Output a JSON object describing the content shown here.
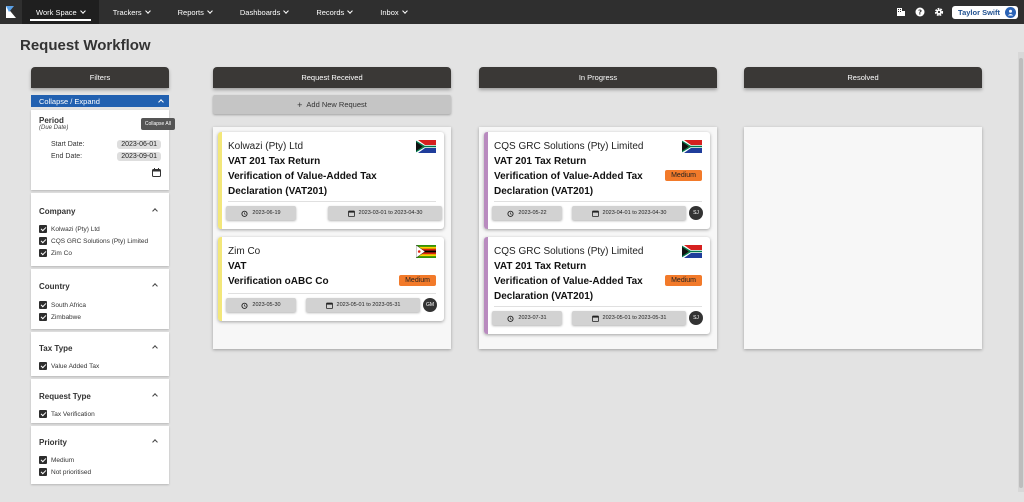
{
  "nav": {
    "items": [
      {
        "label": "Work Space",
        "active": true
      },
      {
        "label": "Trackers"
      },
      {
        "label": "Reports"
      },
      {
        "label": "Dashboards"
      },
      {
        "label": "Records"
      },
      {
        "label": "Inbox"
      }
    ],
    "user_name": "Taylor Swift"
  },
  "page": {
    "title": "Request Workflow"
  },
  "filters": {
    "header": "Filters",
    "collapse_label": "Collapse / Expand",
    "tooltip": "Collapse All",
    "period": {
      "title": "Period",
      "subtitle": "(Due Date)",
      "start_label": "Start Date:",
      "start_value": "2023-06-01",
      "end_label": "End Date:",
      "end_value": "2023-09-01"
    },
    "company": {
      "title": "Company",
      "options": [
        "Kolwazi (Pty) Ltd",
        "CQS GRC Solutions (Pty) Limited",
        "Zim Co"
      ]
    },
    "country": {
      "title": "Country",
      "options": [
        "South Africa",
        "Zimbabwe"
      ]
    },
    "tax_type": {
      "title": "Tax Type",
      "options": [
        "Value Added Tax"
      ]
    },
    "request_type": {
      "title": "Request Type",
      "options": [
        "Tax Verification"
      ]
    },
    "priority": {
      "title": "Priority",
      "options": [
        "Medium",
        "Not prioritised"
      ]
    }
  },
  "columns": {
    "received": {
      "title": "Request Received",
      "add_label": "Add New Request",
      "cards": [
        {
          "company": "Kolwazi (Pty) Ltd",
          "tax": "VAT 201 Tax Return",
          "desc1": "Verification of Value-Added Tax",
          "desc2": "Declaration (VAT201)",
          "due": "2023-06-19",
          "range": "2023-03-01 to 2023-04-30",
          "stripe_color": "#f3e77a"
        },
        {
          "company": "Zim Co",
          "tax": "VAT",
          "desc1": "Verification oABC Co",
          "priority": "Medium",
          "due": "2023-05-30",
          "range": "2023-05-01 to 2023-05-31",
          "avatar": "GM",
          "stripe_color": "#f3e77a"
        }
      ]
    },
    "progress": {
      "title": "In Progress",
      "cards": [
        {
          "company": "CQS GRC Solutions (Pty) Limited",
          "tax": "VAT 201 Tax Return",
          "desc1": "Verification of Value-Added Tax",
          "desc2": "Declaration (VAT201)",
          "priority": "Medium",
          "due": "2023-05-22",
          "range": "2023-04-01 to 2023-04-30",
          "avatar": "SJ",
          "stripe_color": "#b98bbf"
        },
        {
          "company": "CQS GRC Solutions (Pty) Limited",
          "tax": "VAT 201 Tax Return",
          "desc1": "Verification of Value-Added Tax",
          "desc2": "Declaration (VAT201)",
          "priority": "Medium",
          "due": "2023-07-31",
          "range": "2023-05-01 to 2023-05-31",
          "avatar": "SJ",
          "stripe_color": "#b98bbf"
        }
      ]
    },
    "resolved": {
      "title": "Resolved"
    }
  },
  "colors": {
    "nav_bg": "#2f2f2f",
    "accent_blue": "#2160b0",
    "priority_medium": "#f27a2a"
  }
}
